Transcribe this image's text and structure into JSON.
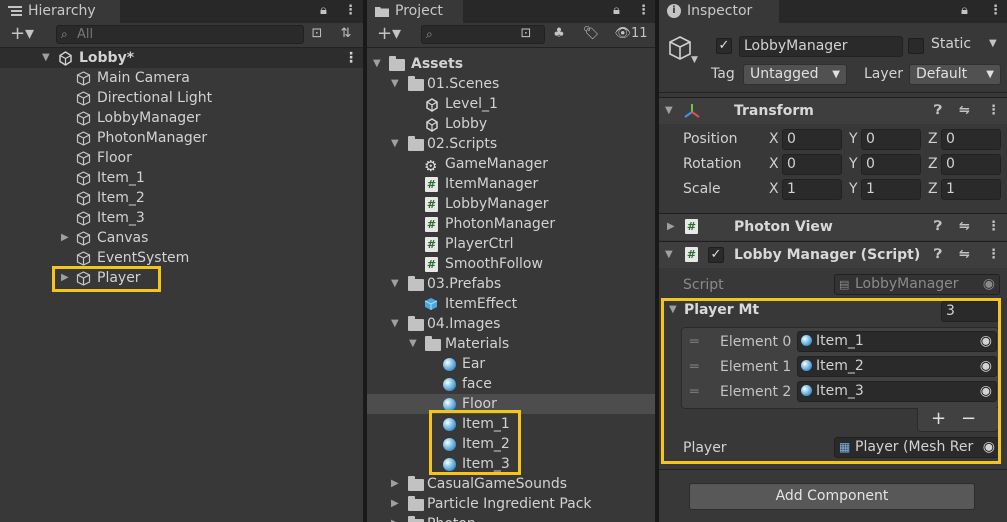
{
  "hierarchy": {
    "tab_label": "Hierarchy",
    "search_placeholder": "All",
    "scene_name": "Lobby*",
    "items": [
      {
        "label": "Main Camera"
      },
      {
        "label": "Directional Light"
      },
      {
        "label": "LobbyManager"
      },
      {
        "label": "PhotonManager"
      },
      {
        "label": "Floor"
      },
      {
        "label": "Item_1"
      },
      {
        "label": "Item_2"
      },
      {
        "label": "Item_3"
      },
      {
        "label": "Canvas"
      },
      {
        "label": "EventSystem"
      },
      {
        "label": "Player"
      }
    ]
  },
  "project": {
    "tab_label": "Project",
    "hidden_count": "11",
    "tree": [
      {
        "label": "Assets"
      },
      {
        "label": "01.Scenes"
      },
      {
        "label": "Level_1"
      },
      {
        "label": "Lobby"
      },
      {
        "label": "02.Scripts"
      },
      {
        "label": "GameManager"
      },
      {
        "label": "ItemManager"
      },
      {
        "label": "LobbyManager"
      },
      {
        "label": "PhotonManager"
      },
      {
        "label": "PlayerCtrl"
      },
      {
        "label": "SmoothFollow"
      },
      {
        "label": "03.Prefabs"
      },
      {
        "label": "ItemEffect"
      },
      {
        "label": "04.Images"
      },
      {
        "label": "Materials"
      },
      {
        "label": "Ear"
      },
      {
        "label": "face"
      },
      {
        "label": "Floor"
      },
      {
        "label": "Item_1"
      },
      {
        "label": "Item_2"
      },
      {
        "label": "Item_3"
      },
      {
        "label": "CasualGameSounds"
      },
      {
        "label": "Particle Ingredient Pack"
      },
      {
        "label": "Photon"
      }
    ]
  },
  "inspector": {
    "tab_label": "Inspector",
    "object_name": "LobbyManager",
    "static_label": "Static",
    "tag_label": "Tag",
    "tag_value": "Untagged",
    "layer_label": "Layer",
    "layer_value": "Default",
    "transform": {
      "title": "Transform",
      "position_label": "Position",
      "rotation_label": "Rotation",
      "scale_label": "Scale",
      "x": "X",
      "y": "Y",
      "z": "Z",
      "position": [
        "0",
        "0",
        "0"
      ],
      "rotation": [
        "0",
        "0",
        "0"
      ],
      "scale": [
        "1",
        "1",
        "1"
      ]
    },
    "photon_view": {
      "title": "Photon View"
    },
    "lobby_manager": {
      "title": "Lobby Manager (Script)",
      "script_label": "Script",
      "script_value": "LobbyManager",
      "player_mt_label": "Player Mt",
      "player_mt_size": "3",
      "elements": [
        {
          "label": "Element 0",
          "value": "Item_1"
        },
        {
          "label": "Element 1",
          "value": "Item_2"
        },
        {
          "label": "Element 2",
          "value": "Item_3"
        }
      ],
      "plus": "+",
      "minus": "−",
      "player_label": "Player",
      "player_value": "Player (Mesh Rer"
    },
    "add_component": "Add Component"
  },
  "colors": {
    "highlight": "#f5c518",
    "panel_bg": "#383838",
    "selected_row": "#4d4d4d"
  }
}
